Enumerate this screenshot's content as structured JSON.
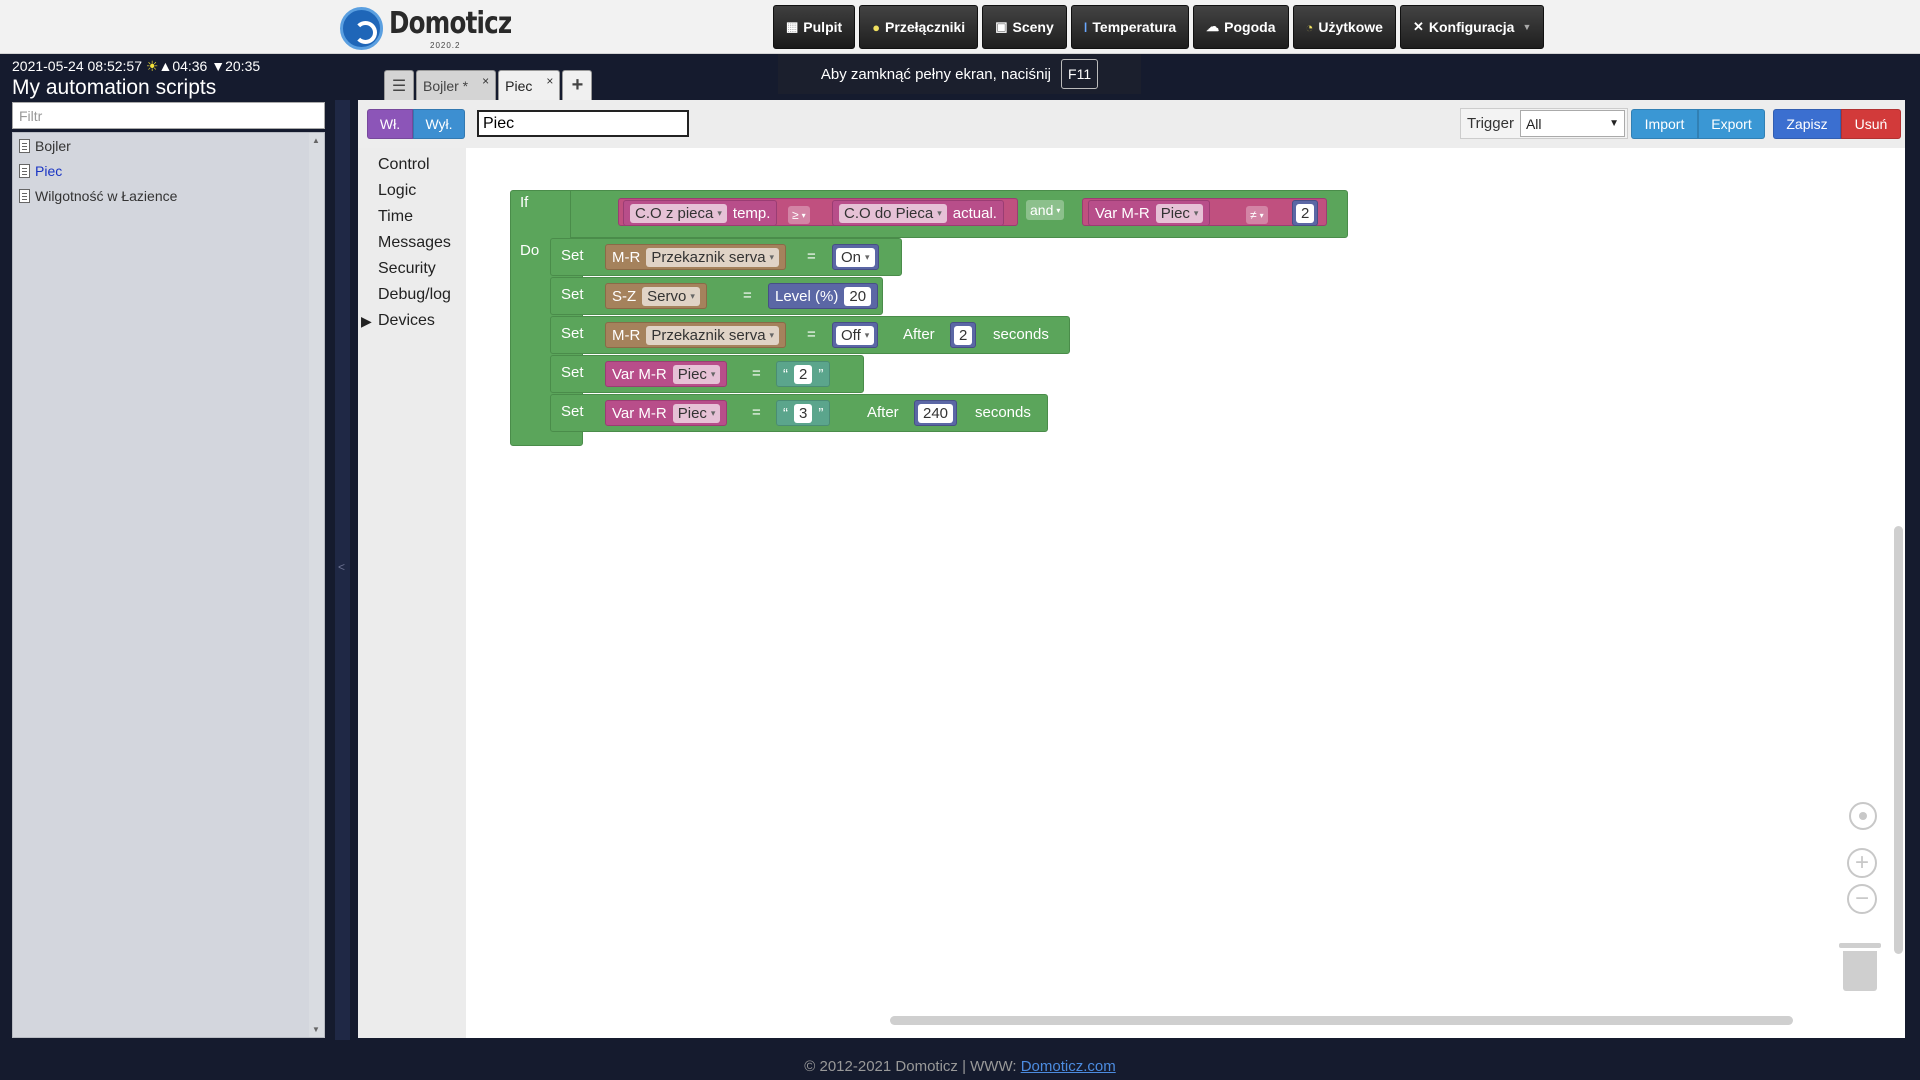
{
  "brand": {
    "name": "Domoticz",
    "version": "2020.2"
  },
  "nav": [
    {
      "label": "Pulpit",
      "icon": "dashboard-icon"
    },
    {
      "label": "Przełączniki",
      "icon": "lightbulb-icon"
    },
    {
      "label": "Sceny",
      "icon": "scene-icon"
    },
    {
      "label": "Temperatura",
      "icon": "thermometer-icon"
    },
    {
      "label": "Pogoda",
      "icon": "cloud-icon"
    },
    {
      "label": "Użytkowe",
      "icon": "utility-icon"
    },
    {
      "label": "Konfiguracja",
      "icon": "wrench-icon"
    }
  ],
  "fullscreen_hint": {
    "text": "Aby zamknąć pełny ekran, naciśnij",
    "key": "F11"
  },
  "status": {
    "datetime": "2021-05-24 08:52:57",
    "sunrise": "04:36",
    "sunset": "20:35"
  },
  "panel": {
    "title": "My automation scripts",
    "filter_placeholder": "Filtr"
  },
  "scripts": [
    {
      "name": "Bojler",
      "active": false
    },
    {
      "name": "Piec",
      "active": true
    },
    {
      "name": "Wilgotność w Łazience",
      "active": false
    }
  ],
  "tabs": [
    {
      "label": "Bojler *",
      "active": false
    },
    {
      "label": "Piec",
      "active": true
    }
  ],
  "toolbar": {
    "on_label": "Wł.",
    "off_label": "Wył.",
    "script_name": "Piec",
    "trigger_label": "Trigger",
    "trigger_value": "All",
    "import_label": "Import",
    "export_label": "Export",
    "save_label": "Zapisz",
    "delete_label": "Usuń"
  },
  "toolbox": [
    "Control",
    "Logic",
    "Time",
    "Messages",
    "Security",
    "Debug/log",
    "Devices"
  ],
  "blocks": {
    "if_kw": "If",
    "do_kw": "Do",
    "cond1_device": "C.O z pieca",
    "cond1_prop": "temp.",
    "cond1_op": "≥",
    "cond1_rhs_device": "C.O do Pieca",
    "cond1_rhs_prop": "actual.",
    "and_kw": "and",
    "cond2_var_prefix": "Var M-R",
    "cond2_var": "Piec",
    "cond2_op": "≠",
    "cond2_val": "2",
    "set_kw": "Set",
    "r1_prefix": "M-R",
    "r1_device": "Przekaznik serva",
    "r1_eq": "=",
    "r1_val": "On",
    "r2_prefix": "S-Z",
    "r2_device": "Servo",
    "r2_eq": "=",
    "r2_level": "Level (%)",
    "r2_val": "20",
    "r3_prefix": "M-R",
    "r3_device": "Przekaznik serva",
    "r3_eq": "=",
    "r3_val": "Off",
    "r3_after": "After",
    "r3_sec": "2",
    "r3_unit": "seconds",
    "r4_prefix": "Var M-R",
    "r4_var": "Piec",
    "r4_eq": "=",
    "r4_val": "2",
    "r5_prefix": "Var M-R",
    "r5_var": "Piec",
    "r5_eq": "=",
    "r5_val": "3",
    "r5_after": "After",
    "r5_sec": "240",
    "r5_unit": "seconds",
    "quote_open": "“",
    "quote_close": "”"
  },
  "footer": {
    "text": "© 2012-2021 Domoticz | WWW: ",
    "link": "Domoticz.com"
  }
}
